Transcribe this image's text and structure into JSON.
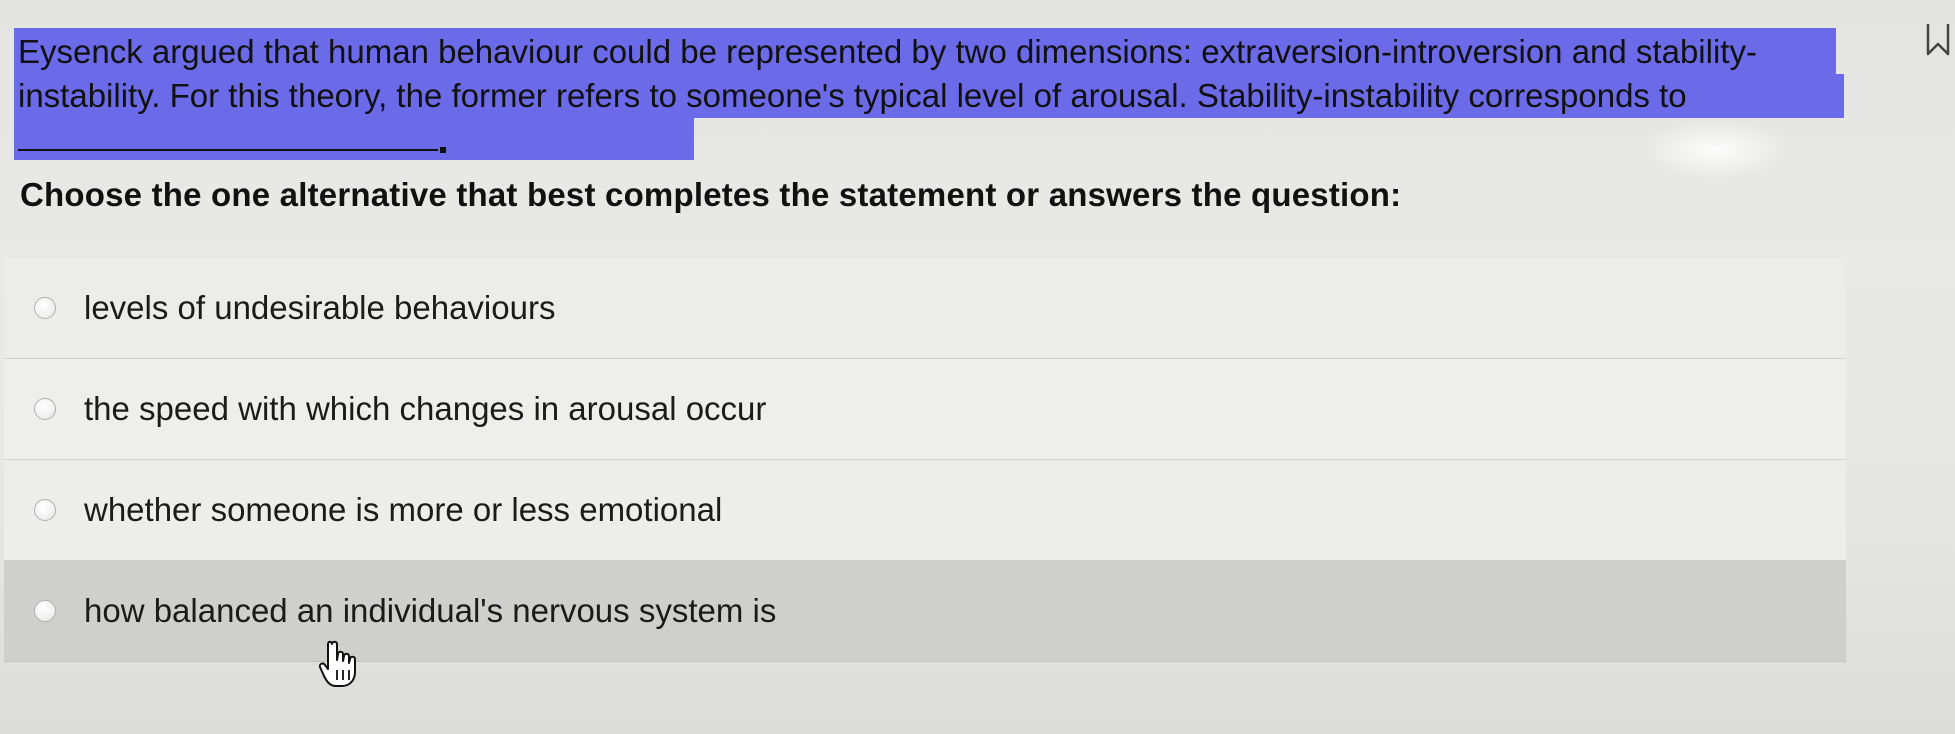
{
  "question": {
    "text": "Eysenck argued that human behaviour could be represented by two dimensions: extraversion-introversion and stability-instability. For this theory, the former refers to someone's typical level of arousal. Stability-instability corresponds to"
  },
  "instructions": "Choose the one alternative that best completes the statement or answers the question:",
  "options": [
    {
      "label": "levels of undesirable behaviours"
    },
    {
      "label": "the speed with which changes in arousal occur"
    },
    {
      "label": "whether someone is more or less emotional"
    },
    {
      "label": "how balanced an individual's nervous system is"
    }
  ],
  "icons": {
    "cursor": "hand-pointer-icon",
    "corner": "bookmark-icon"
  },
  "colors": {
    "highlight": "#6b6ae8",
    "hovered_option": "#cfcfcd"
  }
}
